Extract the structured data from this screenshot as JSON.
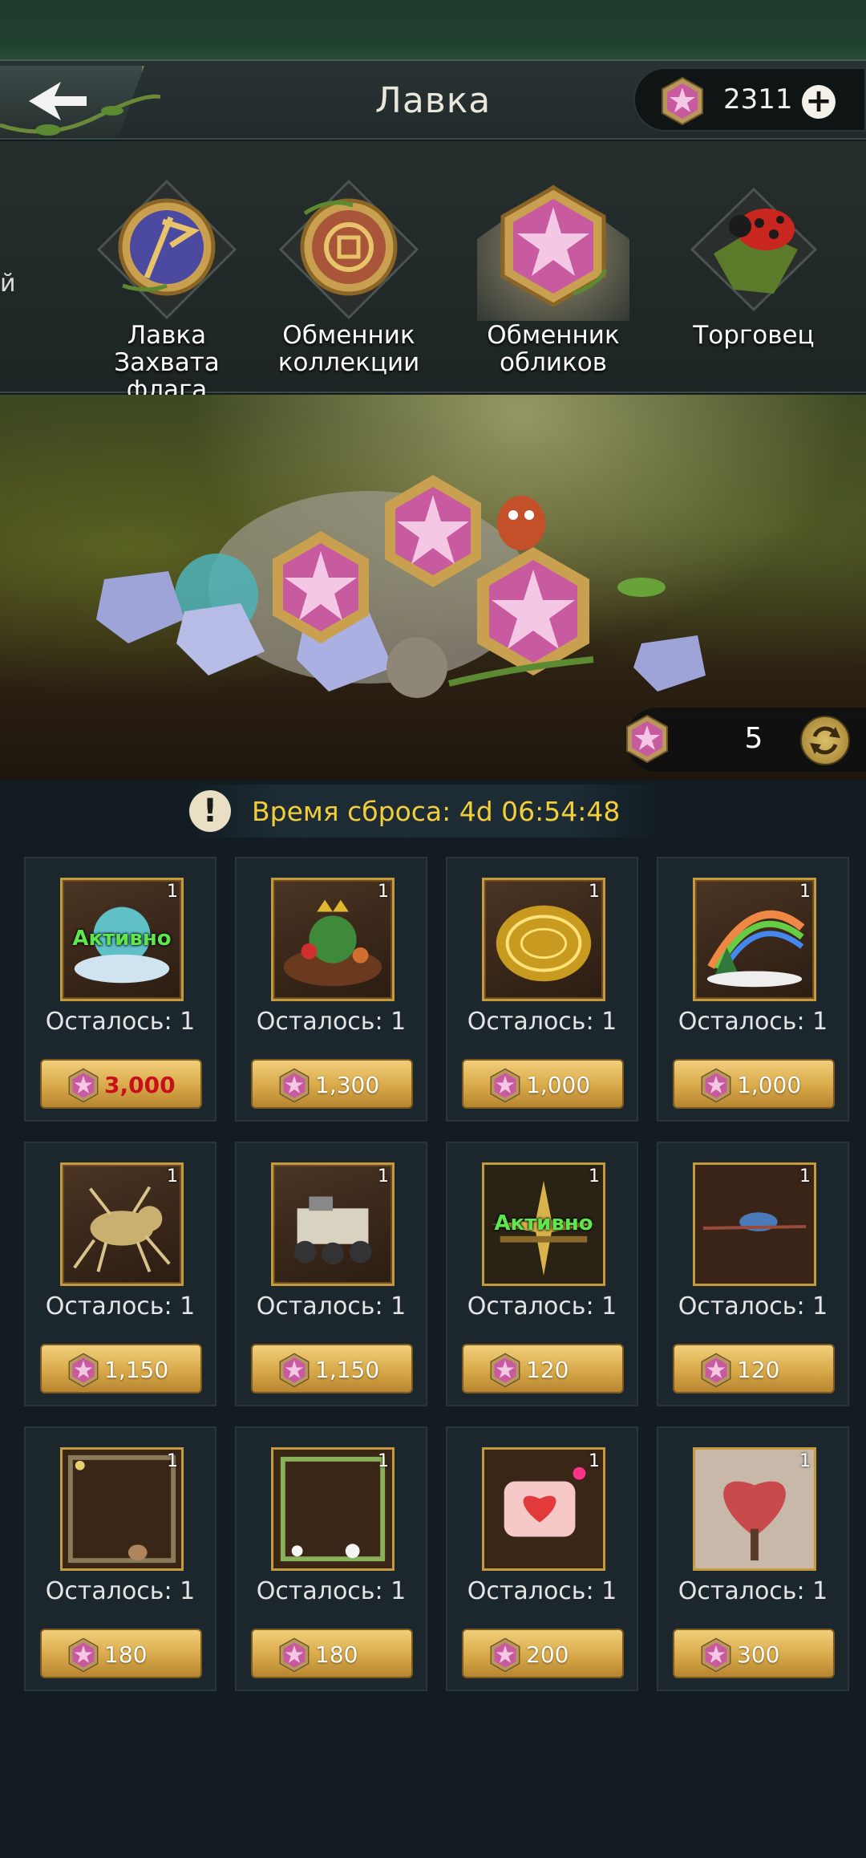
{
  "header": {
    "title": "Лавка",
    "currency_amount": "2311"
  },
  "tabs": [
    {
      "label": "й"
    },
    {
      "label": "Лавка Захвата\nфлага"
    },
    {
      "label": "Обменник\nколлекции"
    },
    {
      "label": "Обменник\nобликов",
      "active": true
    },
    {
      "label": "Торговец"
    }
  ],
  "banner": {
    "refresh_cost": "5"
  },
  "reset": {
    "text": "Время сброса: 4d 06:54:48"
  },
  "items": [
    {
      "name": "crystal-nest-skin",
      "qty": "1",
      "active_label": "Активно",
      "remaining": "Осталось: 1",
      "price": "3,000",
      "price_insufficient": true
    },
    {
      "name": "festive-garden-skin",
      "qty": "1",
      "active_label": "",
      "remaining": "Осталось: 1",
      "price": "1,300"
    },
    {
      "name": "golden-rune-platform",
      "qty": "1",
      "active_label": "",
      "remaining": "Осталось: 1",
      "price": "1,000"
    },
    {
      "name": "rainbow-winter-skin",
      "qty": "1",
      "active_label": "",
      "remaining": "Осталось: 1",
      "price": "1,000"
    },
    {
      "name": "golden-ant-skin",
      "qty": "1",
      "active_label": "",
      "remaining": "Осталось: 1",
      "price": "1,150"
    },
    {
      "name": "rover-skin",
      "qty": "1",
      "active_label": "",
      "remaining": "Осталось: 1",
      "price": "1,150"
    },
    {
      "name": "golden-rays-effect",
      "qty": "1",
      "active_label": "Активно",
      "remaining": "Осталось: 1",
      "price": "120"
    },
    {
      "name": "beetle-effect",
      "qty": "1",
      "active_label": "",
      "remaining": "Осталось: 1",
      "price": "120"
    },
    {
      "name": "bunny-frame",
      "qty": "1",
      "active_label": "",
      "remaining": "Осталось: 1",
      "price": "180"
    },
    {
      "name": "flower-frame",
      "qty": "1",
      "active_label": "",
      "remaining": "Осталось: 1",
      "price": "180"
    },
    {
      "name": "heart-chat-bubble",
      "qty": "1",
      "active_label": "",
      "remaining": "Осталось: 1",
      "price": "200"
    },
    {
      "name": "heart-tree-avatar",
      "qty": "1",
      "active_label": "",
      "remaining": "Осталось: 1",
      "price": "300"
    }
  ],
  "colors": {
    "accent_gold": "#d8a94a",
    "timer_yellow": "#f2cf38",
    "active_green": "#5ee64d",
    "insufficient_red": "#c8101a",
    "gem_pink": "#c85aa0"
  }
}
